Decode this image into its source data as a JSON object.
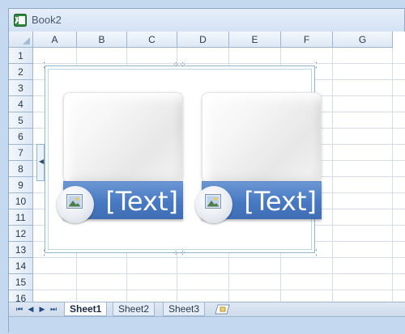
{
  "window": {
    "title": "Book2"
  },
  "grid": {
    "columns": [
      "A",
      "B",
      "C",
      "D",
      "E",
      "F",
      "G"
    ],
    "rows": [
      "1",
      "2",
      "3",
      "4",
      "5",
      "6",
      "7",
      "8",
      "9",
      "10",
      "11",
      "12",
      "13",
      "14",
      "15",
      "16"
    ]
  },
  "smartart": {
    "cards": [
      {
        "label": "[Text]",
        "picture_icon": "picture-placeholder-icon"
      },
      {
        "label": "[Text]",
        "picture_icon": "picture-placeholder-icon"
      }
    ],
    "accent_color": "#4a7cc4"
  },
  "sheets": {
    "tabs": [
      {
        "label": "Sheet1",
        "active": true
      },
      {
        "label": "Sheet2",
        "active": false
      },
      {
        "label": "Sheet3",
        "active": false
      }
    ],
    "nav": [
      "first-sheet-icon",
      "prev-sheet-icon",
      "next-sheet-icon",
      "last-sheet-icon"
    ],
    "new_sheet_icon": "insert-sheet-icon"
  }
}
